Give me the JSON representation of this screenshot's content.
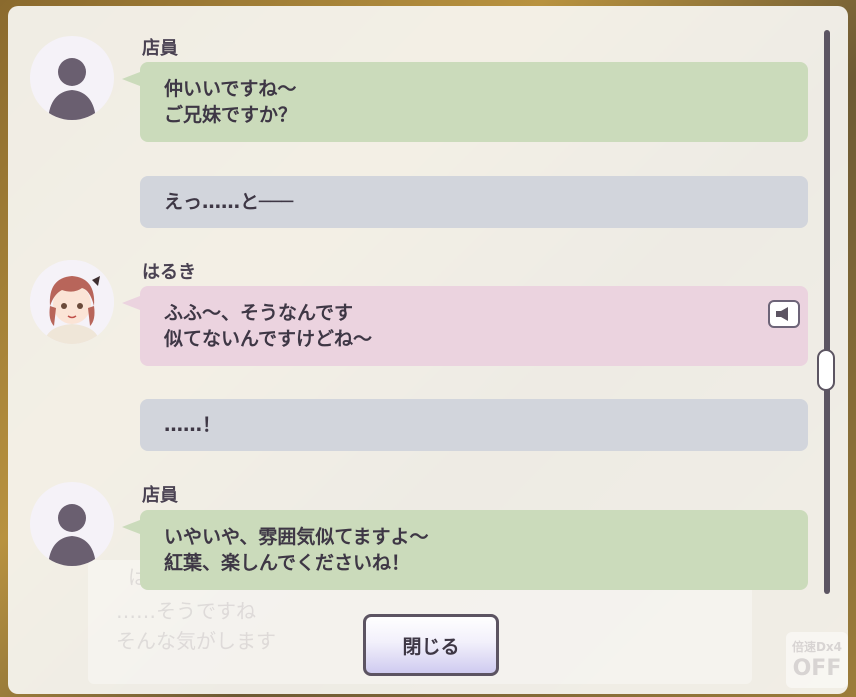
{
  "background": {
    "ghost_name": "は",
    "ghost_line1": "……そうですね",
    "ghost_line2": "そんな気がします",
    "auto_label": "倍速Dx4",
    "auto_state": "OFF"
  },
  "log": [
    {
      "speaker": "店員",
      "avatar": "silhouette-icon",
      "color": "green",
      "lines": [
        "仲いいですね～",
        "ご兄妹ですか？"
      ]
    },
    {
      "speaker": "",
      "color": "gray",
      "lines": [
        "えっ……と───"
      ]
    },
    {
      "speaker": "はるき",
      "avatar": "haruki-portrait",
      "color": "pink",
      "lines": [
        "ふふ～、そうなんです",
        "似てないんですけどね～"
      ],
      "voice": "speaker-icon"
    },
    {
      "speaker": "",
      "color": "gray",
      "lines": [
        "……！"
      ]
    },
    {
      "speaker": "店員",
      "avatar": "silhouette-icon",
      "color": "green",
      "lines": [
        "いやいや、雰囲気似てますよ～",
        "紅葉、楽しんでくださいね！"
      ]
    }
  ],
  "close_label": "閉じる",
  "colors": {
    "green_bubble": "#cbdbbb",
    "gray_bubble": "#d2d5dc",
    "pink_bubble": "#ebd3df",
    "text": "#3e3745",
    "scrollbar": "#5c5562"
  }
}
